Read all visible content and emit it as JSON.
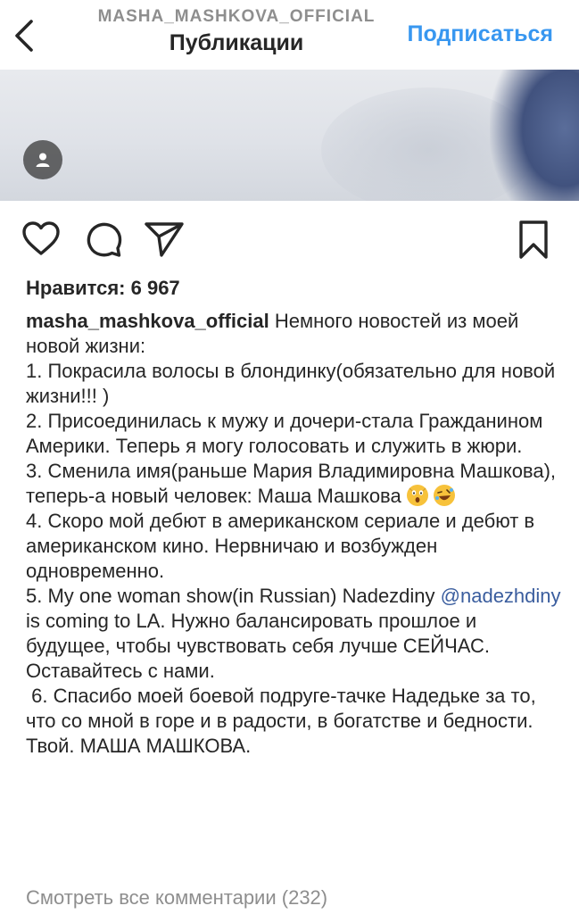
{
  "header": {
    "username": "MASHA_MASHKOVA_OFFICIAL",
    "title": "Публикации",
    "follow_label": "Подписаться"
  },
  "icons": {
    "back": "chevron-left-icon",
    "user_tag": "user-icon",
    "like": "heart-icon",
    "comment": "comment-icon",
    "share": "paper-plane-icon",
    "save": "bookmark-icon"
  },
  "post": {
    "likes_label": "Нравится: 6 967",
    "author": "masha_mashkova_official",
    "caption_intro": " Немного новостей из моей новой жизни:",
    "items": [
      "1. Покрасила волосы в блондинку(обязательно для новой жизни!!! )",
      "2. Присоединилась к мужу и дочери-стала Гражданином Америки. Теперь я могу голосовать и служить в жюри."
    ],
    "item3_text": "3. Сменила имя(раньше Мария Владимировна Машкова), теперь-а новый человек: Маша Машкова ",
    "item4": "4. Скоро мой дебют в американском сериале и дебют в американском кино. Нервничаю и возбужден одновременно.",
    "item5_before": "5. My one woman show(in Russian) Nadezdiny ",
    "item5_mention": "@nadezhdiny",
    "item5_after": " is coming to LA. Нужно балансировать прошлое и будущее, чтобы чувствовать себя лучше СЕЙЧАС. Оставайтесь с нами.",
    "item6": " 6. Спасибо моей боевой подруге-тачке Надедьке за то, что со мной в горе и в радости, в богатстве и бедности.",
    "signature": "Твой. МАША МАШКОВА.",
    "view_comments": "Смотреть все комментарии (232)"
  },
  "colors": {
    "link_blue": "#3897f0",
    "mention_blue": "#3a5d9e",
    "muted_gray": "#8e8e8e",
    "text": "#262626"
  }
}
